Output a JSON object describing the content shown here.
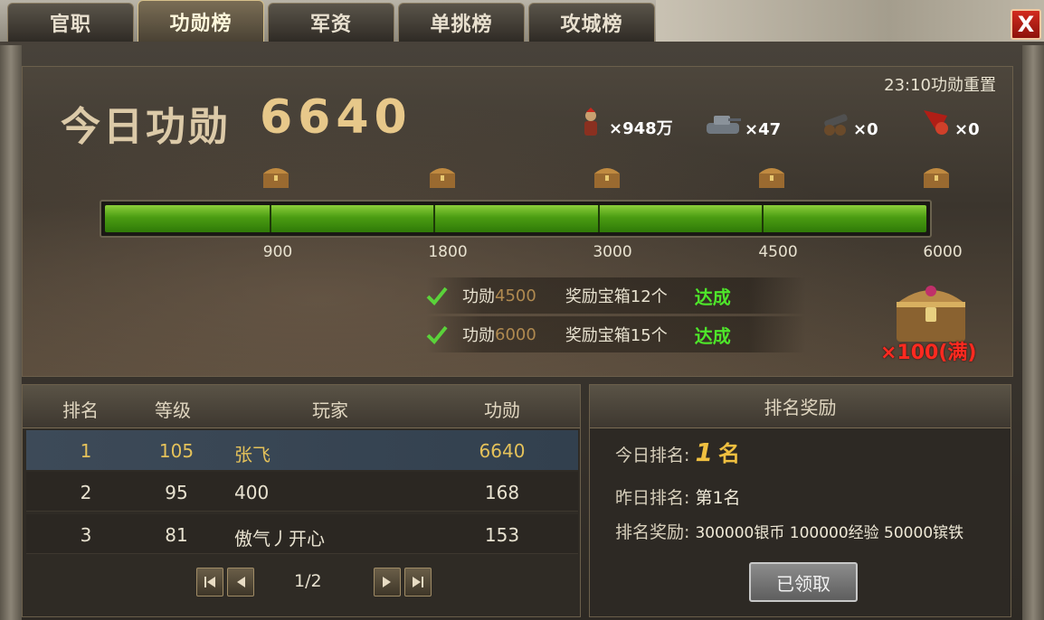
{
  "tabs": [
    {
      "label": "官职"
    },
    {
      "label": "功勋榜"
    },
    {
      "label": "军资"
    },
    {
      "label": "单挑榜"
    },
    {
      "label": "攻城榜"
    }
  ],
  "close_label": "X",
  "summary": {
    "today_label": "今日功勋",
    "today_value": "6640",
    "reset_note": "23:10功勋重置"
  },
  "resources": [
    {
      "icon": "soldier-icon",
      "amount": "×948万"
    },
    {
      "icon": "tank-icon",
      "amount": "×47"
    },
    {
      "icon": "cannon-icon",
      "amount": "×0"
    },
    {
      "icon": "banner-icon",
      "amount": "×0"
    }
  ],
  "progress": {
    "ticks": [
      "900",
      "1800",
      "3000",
      "4500",
      "6000"
    ],
    "fill_fraction": 1.0
  },
  "achievements": [
    {
      "key": "功勋",
      "value": "4500",
      "reward": "奖励宝箱12个",
      "status": "达成"
    },
    {
      "key": "功勋",
      "value": "6000",
      "reward": "奖励宝箱15个",
      "status": "达成"
    }
  ],
  "big_chest_count": "×100(满)",
  "rank_table": {
    "headers": [
      "排名",
      "等级",
      "玩家",
      "功勋"
    ],
    "rows": [
      {
        "rank": "1",
        "level": "105",
        "player": "张飞",
        "merit": "6640"
      },
      {
        "rank": "2",
        "level": "95",
        "player": "400",
        "merit": "168"
      },
      {
        "rank": "3",
        "level": "81",
        "player": "傲气丿开心",
        "merit": "153"
      }
    ],
    "page": "1/2"
  },
  "reward_panel": {
    "title": "排名奖励",
    "today_rank_label": "今日排名:",
    "today_rank_value": "1",
    "today_rank_suffix": "名",
    "yesterday_rank_label": "昨日排名:",
    "yesterday_rank_value": "第1名",
    "rank_reward_label": "排名奖励:",
    "rank_reward_value": "300000银币  100000经验  50000镔铁",
    "claimed_label": "已领取"
  },
  "colors": {
    "progress_green": "#4b9c12",
    "achieved_green": "#4ee62a",
    "gold_text": "#e5c25a",
    "close_red": "#d22a1e"
  }
}
